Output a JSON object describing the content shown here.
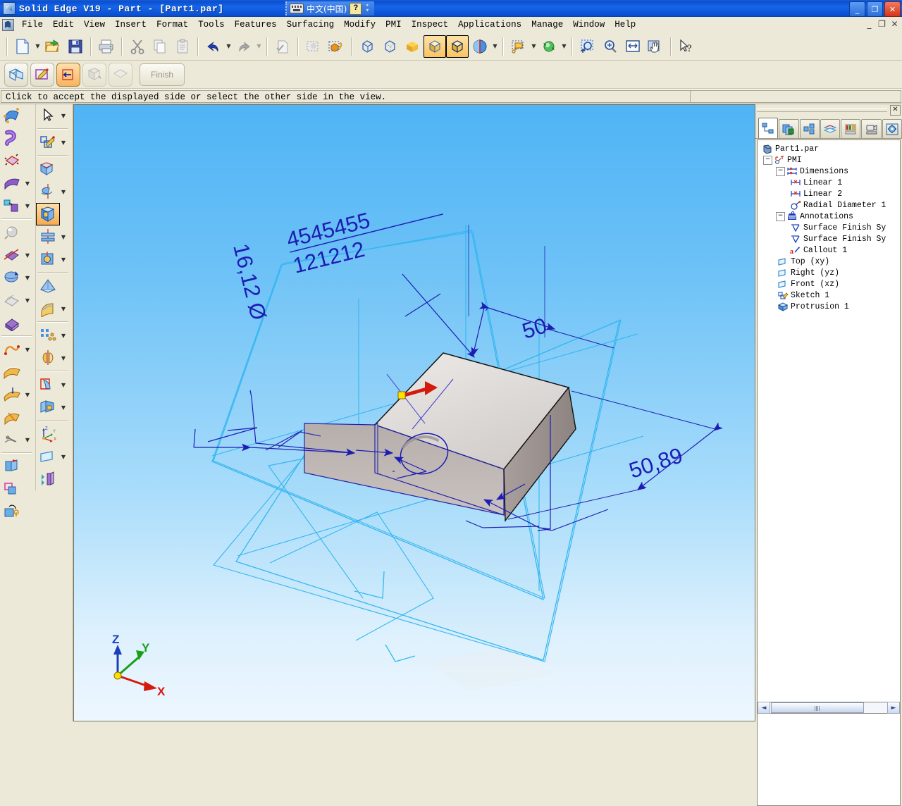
{
  "window": {
    "title": "Solid Edge V19 - Part - [Part1.par]",
    "app_icon": "solid-edge-icon",
    "ime": {
      "label": "中文(中国)",
      "keyboard_icon": "keyboard-icon",
      "help_icon": "help-icon",
      "grip_icon": "grip-icon"
    },
    "buttons": {
      "minimize": "_",
      "restore": "❐",
      "close": "✕"
    },
    "doc_buttons": {
      "minimize": "_",
      "restore": "❐",
      "close": "✕"
    }
  },
  "menu": {
    "sys_icon": "document-sys-icon",
    "items": [
      {
        "label": "File"
      },
      {
        "label": "Edit"
      },
      {
        "label": "View"
      },
      {
        "label": "Insert"
      },
      {
        "label": "Format"
      },
      {
        "label": "Tools"
      },
      {
        "label": "Features"
      },
      {
        "label": "Surfacing"
      },
      {
        "label": "Modify"
      },
      {
        "label": "PMI"
      },
      {
        "label": "Inspect"
      },
      {
        "label": "Applications"
      },
      {
        "label": "Manage"
      },
      {
        "label": "Window"
      },
      {
        "label": "Help"
      }
    ]
  },
  "toolbar": {
    "buttons": [
      {
        "name": "new-document",
        "icon": "new-page-icon",
        "dropdown": true,
        "enabled": true
      },
      {
        "name": "open-document",
        "icon": "open-folder-icon",
        "dropdown": false,
        "enabled": true
      },
      {
        "name": "save-document",
        "icon": "floppy-save-icon",
        "dropdown": false,
        "enabled": true
      },
      {
        "name": "print",
        "icon": "printer-icon",
        "dropdown": false,
        "enabled": true
      },
      {
        "name": "cut",
        "icon": "scissors-icon",
        "dropdown": false,
        "enabled": false
      },
      {
        "name": "copy",
        "icon": "copy-pages-icon",
        "dropdown": false,
        "enabled": false
      },
      {
        "name": "paste",
        "icon": "clipboard-icon",
        "dropdown": false,
        "enabled": false
      },
      {
        "name": "undo",
        "icon": "undo-arrow-icon",
        "dropdown": true,
        "enabled": true
      },
      {
        "name": "redo",
        "icon": "redo-arrow-icon",
        "dropdown": true,
        "enabled": false
      },
      {
        "name": "update-all",
        "icon": "page-check-icon",
        "dropdown": false,
        "enabled": false
      },
      {
        "name": "select-tool",
        "icon": "dashed-select-icon",
        "dropdown": false,
        "enabled": false
      },
      {
        "name": "select-attach",
        "icon": "select-attach-icon",
        "dropdown": false,
        "enabled": true
      },
      {
        "name": "wireframe",
        "icon": "wireframe-cube-icon",
        "dropdown": false,
        "enabled": true
      },
      {
        "name": "hidden-lines",
        "icon": "hidden-line-cube-icon",
        "dropdown": false,
        "enabled": true
      },
      {
        "name": "shaded-edges-off",
        "icon": "solid-block-icon",
        "dropdown": false,
        "enabled": true
      },
      {
        "name": "shaded-view",
        "icon": "shaded-cube-icon",
        "dropdown": false,
        "enabled": true,
        "selected": true
      },
      {
        "name": "shaded-with-edges",
        "icon": "shaded-edge-cube-icon",
        "dropdown": false,
        "enabled": true,
        "selected": true
      },
      {
        "name": "view-styles",
        "icon": "sphere-halfred-icon",
        "dropdown": true,
        "enabled": true
      },
      {
        "name": "callout",
        "icon": "callout-tag-icon",
        "dropdown": true,
        "enabled": true
      },
      {
        "name": "refresh-view",
        "icon": "green-refresh-icon",
        "dropdown": true,
        "enabled": true
      },
      {
        "name": "zoom-area",
        "icon": "zoom-area-icon",
        "dropdown": false,
        "enabled": true
      },
      {
        "name": "zoom",
        "icon": "magnifier-plus-icon",
        "dropdown": false,
        "enabled": true
      },
      {
        "name": "fit",
        "icon": "fit-window-icon",
        "dropdown": false,
        "enabled": true
      },
      {
        "name": "pan",
        "icon": "pan-hand-icon",
        "dropdown": false,
        "enabled": true
      },
      {
        "name": "help-pointer",
        "icon": "arrow-question-icon",
        "dropdown": false,
        "enabled": true
      }
    ]
  },
  "ribbon": {
    "buttons": [
      {
        "name": "select-plane-step",
        "icon": "plane-select-icon",
        "enabled": true
      },
      {
        "name": "draw-profile-step",
        "icon": "profile-pencil-icon",
        "enabled": true
      },
      {
        "name": "side-step",
        "icon": "side-arrow-icon",
        "enabled": true,
        "selected": true
      },
      {
        "name": "extent-step",
        "icon": "extent-icon",
        "enabled": false
      },
      {
        "name": "treatment-step",
        "icon": "treatment-icon",
        "enabled": false
      }
    ],
    "finish_label": "Finish"
  },
  "prompt": {
    "message": "Click to accept the displayed side or select the other side in the view."
  },
  "left_palette": {
    "column_a": [
      {
        "name": "sweep-protrusion",
        "icon": "sweep-blue-icon",
        "dropdown": false
      },
      {
        "name": "helical-protrusion",
        "icon": "helix-purple-icon",
        "dropdown": false
      },
      {
        "name": "normal-protrusion",
        "icon": "normal-red-icon",
        "dropdown": false
      },
      {
        "name": "thin-wall",
        "icon": "thinwall-purple-icon",
        "dropdown": true
      },
      {
        "name": "lip",
        "icon": "lip-icon",
        "dropdown": true
      },
      {
        "separator": true
      },
      {
        "name": "round",
        "icon": "round-sphere-icon",
        "dropdown": false
      },
      {
        "name": "chamfer",
        "icon": "chamfer-icon",
        "dropdown": true
      },
      {
        "name": "draft",
        "icon": "draft-sphere-icon",
        "dropdown": true
      },
      {
        "name": "thinwall-region",
        "icon": "thinwall-region-icon",
        "dropdown": true
      },
      {
        "name": "rib",
        "icon": "rib-purple-icon",
        "dropdown": false
      },
      {
        "separator": true
      },
      {
        "name": "curve",
        "icon": "curve-orange-icon",
        "dropdown": true
      },
      {
        "name": "bluesurf",
        "icon": "bluesurf-icon",
        "dropdown": false
      },
      {
        "name": "swept-surface",
        "icon": "swept-surface-icon",
        "dropdown": true
      },
      {
        "name": "bounded-surface",
        "icon": "bounded-surface-icon",
        "dropdown": false
      },
      {
        "name": "trim-surface",
        "icon": "trim-surface-icon",
        "dropdown": true
      },
      {
        "separator": true
      },
      {
        "name": "copy-part",
        "icon": "copy-part-icon",
        "dropdown": false
      },
      {
        "name": "part-copy",
        "icon": "part-copy-pink-icon",
        "dropdown": false
      },
      {
        "name": "attach-part",
        "icon": "attach-part-icon",
        "dropdown": false
      }
    ],
    "column_b": [
      {
        "name": "select-tool",
        "icon": "arrow-cursor-icon",
        "dropdown": true
      },
      {
        "separator": true
      },
      {
        "name": "sketch",
        "icon": "sketch-pencil-icon",
        "dropdown": true
      },
      {
        "separator": true
      },
      {
        "name": "protrusion",
        "icon": "protrusion-icon",
        "dropdown": false
      },
      {
        "name": "revolved-protrusion",
        "icon": "revolve-icon",
        "dropdown": true
      },
      {
        "name": "cutout",
        "icon": "cutout-square-icon",
        "dropdown": false,
        "selected": true
      },
      {
        "name": "revolved-cutout",
        "icon": "revolved-cutout-icon",
        "dropdown": true
      },
      {
        "name": "hole",
        "icon": "hole-icon",
        "dropdown": true
      },
      {
        "separator": true
      },
      {
        "name": "thin-region",
        "icon": "tent-icon",
        "dropdown": false
      },
      {
        "name": "web-network",
        "icon": "web-yellow-icon",
        "dropdown": true
      },
      {
        "separator": true
      },
      {
        "name": "pattern",
        "icon": "pattern-dots-icon",
        "dropdown": true
      },
      {
        "name": "mirror-copy",
        "icon": "mirror-gold-icon",
        "dropdown": true
      },
      {
        "separator": true
      },
      {
        "name": "draft-surface",
        "icon": "draft-surface-icon",
        "dropdown": true
      },
      {
        "name": "live-section",
        "icon": "live-section-icon",
        "dropdown": true
      },
      {
        "separator": true
      },
      {
        "name": "coordinate-system",
        "icon": "axis-triad-icon",
        "dropdown": false
      },
      {
        "name": "reference-plane",
        "icon": "reference-plane-icon",
        "dropdown": true
      },
      {
        "name": "parallel-plane",
        "icon": "parallel-plane-icon",
        "dropdown": false
      }
    ]
  },
  "pathfinder": {
    "close_label": "✕",
    "tabs": [
      {
        "name": "feature-pathfinder",
        "icon": "pathfinder-tree-icon",
        "selected": true
      },
      {
        "name": "layers",
        "icon": "layers-stack-icon",
        "selected": false
      },
      {
        "name": "family-of-parts",
        "icon": "family-parts-icon",
        "selected": false
      },
      {
        "name": "layers-pane",
        "icon": "layers-red-icon",
        "selected": false
      },
      {
        "name": "sensors",
        "icon": "sensors-gauge-icon",
        "selected": false
      },
      {
        "name": "view-camera",
        "icon": "camera-view-icon",
        "selected": false
      },
      {
        "name": "settings",
        "icon": "blue-gear-icon",
        "selected": false
      }
    ],
    "tree": [
      {
        "depth": 0,
        "label": "Part1.par",
        "icon": "part-file-icon",
        "expander": "none"
      },
      {
        "depth": 1,
        "label": "PMI",
        "icon": "pmi-icon",
        "expander": "minus"
      },
      {
        "depth": 2,
        "label": "Dimensions",
        "icon": "dimensions-icon",
        "expander": "minus"
      },
      {
        "depth": 3,
        "label": "Linear 1",
        "icon": "linear-dim-icon",
        "expander": "none"
      },
      {
        "depth": 3,
        "label": "Linear 2",
        "icon": "linear-dim-icon",
        "expander": "none"
      },
      {
        "depth": 3,
        "label": "Radial Diameter 1",
        "icon": "radial-dim-icon",
        "expander": "none"
      },
      {
        "depth": 2,
        "label": "Annotations",
        "icon": "annotations-icon",
        "expander": "minus"
      },
      {
        "depth": 3,
        "label": "Surface Finish Sy",
        "icon": "surface-finish-icon",
        "expander": "none"
      },
      {
        "depth": 3,
        "label": "Surface Finish Sy",
        "icon": "surface-finish-icon",
        "expander": "none"
      },
      {
        "depth": 3,
        "label": "Callout 1",
        "icon": "callout-icon",
        "expander": "none"
      },
      {
        "depth": 1,
        "label": "Top (xy)",
        "icon": "plane-icon",
        "expander": "none"
      },
      {
        "depth": 1,
        "label": "Right (yz)",
        "icon": "plane-icon",
        "expander": "none"
      },
      {
        "depth": 1,
        "label": "Front (xz)",
        "icon": "plane-icon",
        "expander": "none"
      },
      {
        "depth": 1,
        "label": "Sketch 1",
        "icon": "sketch-icon",
        "expander": "none"
      },
      {
        "depth": 1,
        "label": "Protrusion 1",
        "icon": "protrusion-tree-icon",
        "expander": "none"
      }
    ],
    "scrollbar": {
      "left_arrow": "◄",
      "right_arrow": "►"
    }
  },
  "viewport": {
    "annotations": {
      "callout_line1": "4545455",
      "callout_line2": "121212",
      "diameter_dim": "16,12 Ø",
      "linear_dim_1": "50",
      "linear_dim_2": "50,89"
    },
    "triad": {
      "x_label": "X",
      "y_label": "Y",
      "z_label": "Z"
    },
    "colors": {
      "background_top": "#4fb4f5",
      "background_bottom": "#eef7fe",
      "annotation_blue": "#1d1db4",
      "sketch_cyan": "#35b6f0",
      "model_face_light": "#dedad7",
      "model_face_dark": "#9e9491",
      "red_arrow": "#d41a0c",
      "origin_yellow": "#ffe000"
    }
  }
}
